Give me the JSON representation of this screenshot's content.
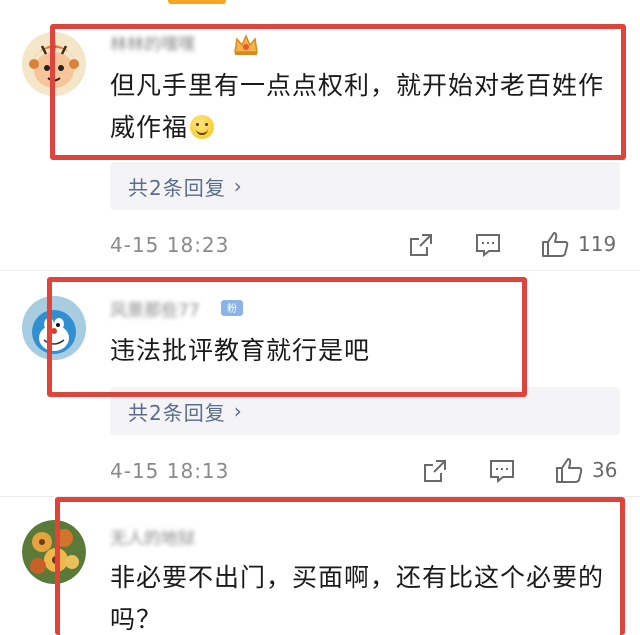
{
  "comments": [
    {
      "username": "林林的嘿嘿",
      "text": "但凡手里有一点点权利，就开始对老百姓作威作福",
      "emoji": "smile-emoji",
      "replies_label": "共2条回复",
      "timestamp": "4-15 18:23",
      "likes": "119"
    },
    {
      "username": "风景那些77",
      "text": "违法批评教育就行是吧",
      "replies_label": "共2条回复",
      "timestamp": "4-15 18:13",
      "likes": "36"
    },
    {
      "username": "无人的地狱",
      "text": "非必要不出门，买面啊，还有比这个必要的吗？"
    }
  ],
  "icons": {
    "reply_arrow": "›",
    "share": "share-icon",
    "comment": "comment-icon",
    "like": "thumbs-up-icon"
  },
  "colors": {
    "highlight_box": "#e0433a",
    "link": "#5a6d8c",
    "tab_accent": "#f5a623"
  }
}
